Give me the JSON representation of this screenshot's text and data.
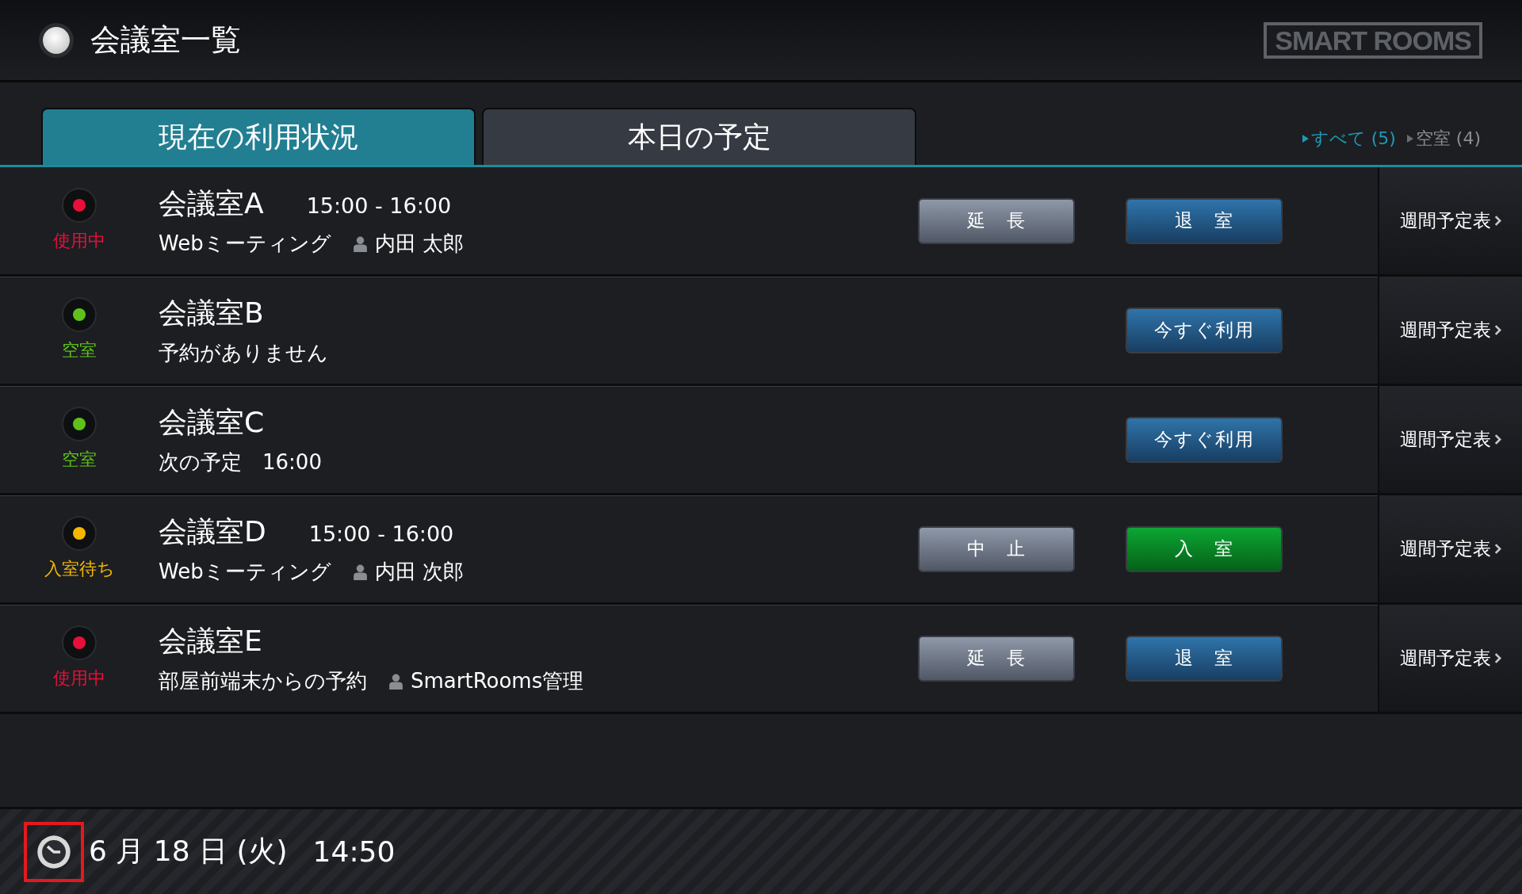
{
  "header": {
    "title": "会議室一覧",
    "logo": "SMART ROOMS"
  },
  "tabs": [
    {
      "label": "現在の利用状況",
      "selected": true
    },
    {
      "label": "本日の予定",
      "selected": false
    }
  ],
  "filters": [
    {
      "label": "すべて (5)",
      "selected": true
    },
    {
      "label": "空室 (4)",
      "selected": false
    }
  ],
  "rooms": [
    {
      "status": "使用中",
      "color": "#e8103a",
      "name": "会議室A",
      "time": "15:00 - 16:00",
      "detail": "Webミーティング",
      "person": "内田 太郎",
      "buttons": [
        {
          "label": "延　長",
          "kind": "secondary"
        },
        {
          "label": "退　室",
          "kind": "primary"
        }
      ],
      "schedule_link": "週間予定表"
    },
    {
      "status": "空室",
      "color": "#5fc21a",
      "name": "会議室B",
      "detail": "予約がありません",
      "buttons": [
        {
          "label": "今すぐ利用",
          "kind": "primary"
        }
      ],
      "schedule_link": "週間予定表"
    },
    {
      "status": "空室",
      "color": "#5fc21a",
      "name": "会議室C",
      "detail": "次の予定　16:00",
      "buttons": [
        {
          "label": "今すぐ利用",
          "kind": "primary"
        }
      ],
      "schedule_link": "週間予定表"
    },
    {
      "status": "入室待ち",
      "color": "#f5b800",
      "name": "会議室D",
      "time": "15:00 - 16:00",
      "detail": "Webミーティング",
      "person": "内田 次郎",
      "buttons": [
        {
          "label": "中　止",
          "kind": "secondary"
        },
        {
          "label": "入　室",
          "kind": "confirm"
        }
      ],
      "schedule_link": "週間予定表"
    },
    {
      "status": "使用中",
      "color": "#e8103a",
      "name": "会議室E",
      "detail": "部屋前端末からの予約",
      "person": "SmartRooms管理",
      "buttons": [
        {
          "label": "延　長",
          "kind": "secondary"
        },
        {
          "label": "退　室",
          "kind": "primary"
        }
      ],
      "schedule_link": "週間予定表"
    }
  ],
  "footer": {
    "date": "6 月 18 日 (火)",
    "time": "14:50",
    "clock_highlighted": true
  }
}
